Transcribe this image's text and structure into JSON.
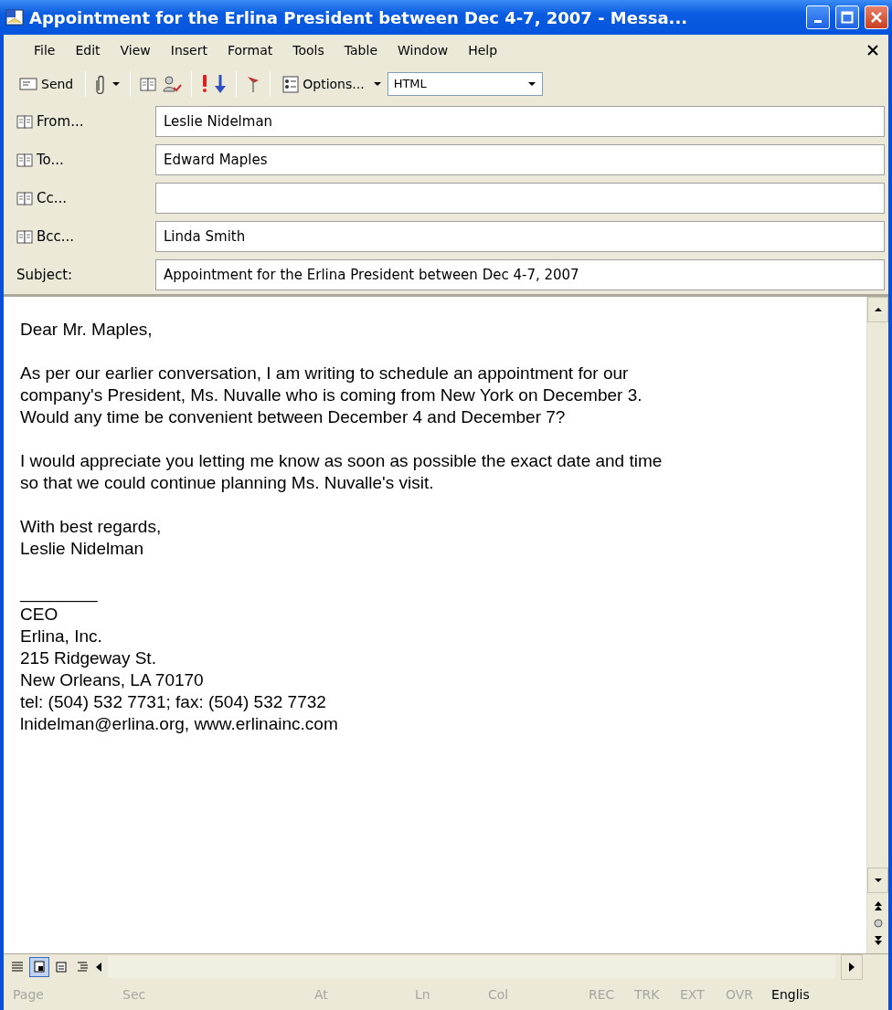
{
  "window": {
    "title": "Appointment for the Erlina President between Dec 4-7, 2007 - Messa..."
  },
  "menu": [
    "File",
    "Edit",
    "View",
    "Insert",
    "Format",
    "Tools",
    "Table",
    "Window",
    "Help"
  ],
  "toolbar": {
    "send": "Send",
    "options": "Options...",
    "format": "HTML"
  },
  "fields": [
    {
      "label": "From...",
      "value": "Leslie Nidelman",
      "book": true
    },
    {
      "label": "To...",
      "value": "Edward Maples",
      "book": true
    },
    {
      "label": "Cc...",
      "book": true
    },
    {
      "label": "Bcc...",
      "value": "Linda Smith",
      "book": true
    },
    {
      "label": "Subject:",
      "value": "Appointment for the Erlina President between Dec 4-7, 2007",
      "book": false
    }
  ],
  "body": [
    [
      "Dear Mr. Maples,"
    ],
    [
      "As per our earlier conversation, I am writing to schedule an appointment for our",
      "company's President, Ms. Nuvalle who is coming from New York on December 3.",
      "Would any time be convenient between December 4 and December 7?"
    ],
    [
      "I would appreciate you letting me know as soon as possible the exact date and time",
      "so that we could continue planning Ms. Nuvalle's visit."
    ],
    [
      "With best regards,",
      "Leslie Nidelman"
    ],
    [
      "________",
      "CEO",
      "Erlina, Inc.",
      "215 Ridgeway St.",
      "New Orleans, LA 70170",
      "tel: (504) 532 7731; fax: (504) 532 7732",
      "lnidelman@erlina.org, www.erlinainc.com"
    ]
  ],
  "view_buttons": [
    {
      "selected": false
    },
    {
      "selected": true
    },
    {
      "selected": false
    },
    {
      "selected": false
    }
  ],
  "status_bar": [
    {
      "text": "Page",
      "disabled": true
    },
    {
      "text": "Sec",
      "disabled": true
    },
    {
      "text": "At",
      "disabled": true
    },
    {
      "text": "Ln",
      "disabled": true
    },
    {
      "text": "Col",
      "disabled": true
    },
    {
      "text": "REC",
      "disabled": true
    },
    {
      "text": "TRK",
      "disabled": true
    },
    {
      "text": "EXT",
      "disabled": true
    },
    {
      "text": "OVR",
      "disabled": true
    },
    {
      "text": "Englis",
      "disabled": false
    }
  ]
}
